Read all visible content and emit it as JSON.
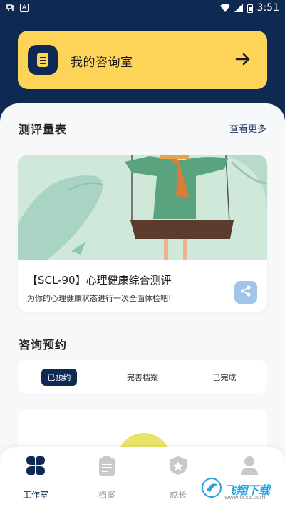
{
  "status_bar": {
    "time": "3:51",
    "left_icon_1": "notification-icon",
    "left_icon_2": "A"
  },
  "consult_banner": {
    "title": "我的咨询室",
    "icon": "document-icon",
    "arrow": "arrow-right-icon"
  },
  "scales": {
    "title": "测评量表",
    "see_more": "查看更多",
    "card": {
      "name": "【SCL-90】心理健康综合测评",
      "desc": "为你的心理健康状态进行一次全面体检吧!",
      "share_icon": "share-icon"
    }
  },
  "appointments": {
    "title": "咨询预约",
    "tabs": [
      {
        "label": "已预约",
        "active": true
      },
      {
        "label": "完善档案",
        "active": false
      },
      {
        "label": "已完成",
        "active": false
      }
    ]
  },
  "bottom_nav": [
    {
      "label": "工作室",
      "icon": "workspace-icon",
      "active": true
    },
    {
      "label": "档案",
      "icon": "clipboard-icon",
      "active": false
    },
    {
      "label": "成长",
      "icon": "badge-icon",
      "active": false
    },
    {
      "label": "",
      "icon": "profile-icon",
      "active": false
    }
  ],
  "watermark": {
    "text": "飞翔下载",
    "url": "www.fxxz.com"
  },
  "colors": {
    "navy": "#0f2a52",
    "yellow": "#fdd457",
    "share_bg": "#9fc5ea"
  }
}
